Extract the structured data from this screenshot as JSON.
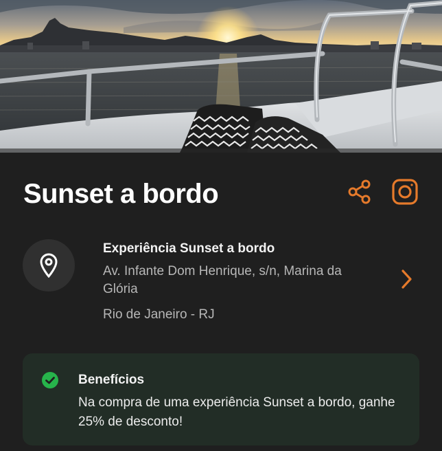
{
  "hero": {
    "image": "sunset-boat-photo"
  },
  "header": {
    "title": "Sunset a bordo"
  },
  "actions": {
    "share_icon": "share-icon",
    "instagram_icon": "instagram-icon",
    "accent_color": "#e57a2b"
  },
  "location": {
    "name": "Experiência Sunset a bordo",
    "address": "Av. Infante Dom Henrique, s/n, Marina da Glória",
    "city": "Rio de Janeiro - RJ",
    "icon": "map-pin-icon"
  },
  "benefits": {
    "title": "Benefícios",
    "description": "Na compra de uma experiência Sunset a bordo, ganhe 25% de desconto!",
    "icon": "check-circle-icon",
    "check_color": "#27b34b"
  }
}
